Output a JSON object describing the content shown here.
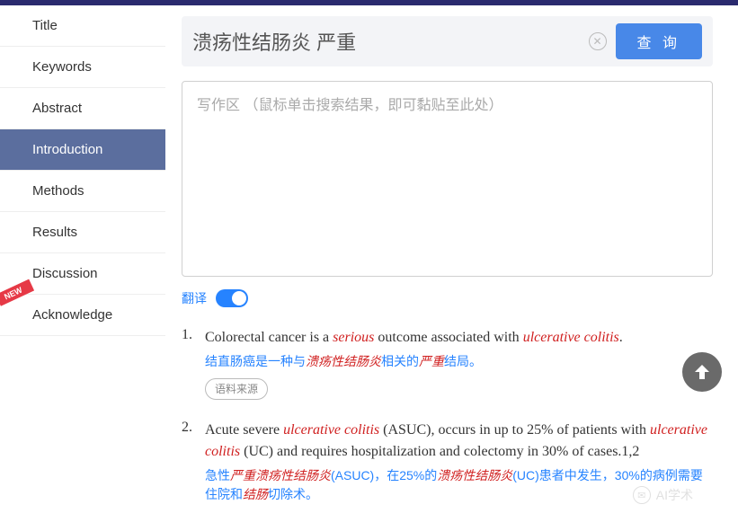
{
  "sidebar": {
    "items": [
      {
        "label": "Title"
      },
      {
        "label": "Keywords"
      },
      {
        "label": "Abstract"
      },
      {
        "label": "Introduction"
      },
      {
        "label": "Methods"
      },
      {
        "label": "Results"
      },
      {
        "label": "Discussion"
      },
      {
        "label": "Acknowledge"
      }
    ],
    "new_badge": "NEW"
  },
  "search": {
    "value": "溃疡性结肠炎 严重",
    "query_button": "查 询"
  },
  "writing_area": {
    "placeholder": "写作区 （鼠标单击搜索结果，即可黏贴至此处）"
  },
  "translate": {
    "label": "翻译"
  },
  "results": [
    {
      "num": "1.",
      "en_parts": [
        "Colorectal cancer is a ",
        "serious",
        " outcome associated with ",
        "ulcerative colitis",
        "."
      ],
      "zh_parts": [
        "结直肠癌是一种与",
        "溃疡性结肠炎",
        "相关的",
        "严重",
        "结局。"
      ],
      "source_label": "语料来源"
    },
    {
      "num": "2.",
      "en_parts": [
        "Acute severe ",
        "ulcerative colitis",
        " (ASUC), occurs in up to 25% of patients with ",
        "ulcerative colitis",
        " (UC) and requires hospitalization and colectomy in 30% of cases.1,2"
      ],
      "zh_parts": [
        "急性",
        "严重溃疡性结肠炎",
        "(ASUC)，在25%的",
        "溃疡性结肠炎",
        "(UC)患者中发生，30%的病例需要住院和",
        "结肠",
        "切除术。"
      ]
    }
  ],
  "watermark": "AI学术"
}
